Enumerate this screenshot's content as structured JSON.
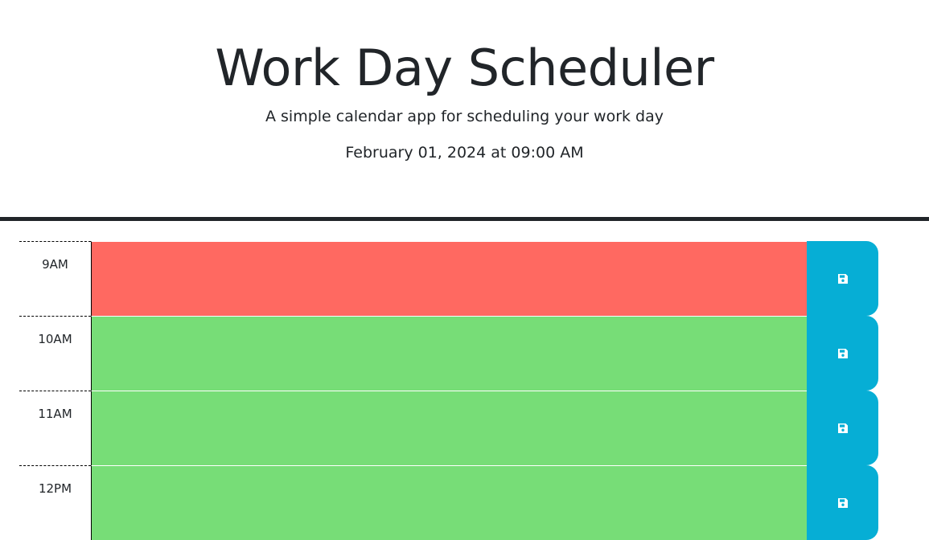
{
  "header": {
    "title": "Work Day Scheduler",
    "lead": "A simple calendar app for scheduling your work day",
    "current_day": "February 01, 2024 at 09:00 AM"
  },
  "colors": {
    "present": "#ff6961",
    "future": "#77dd77",
    "save_button": "#06aed5"
  },
  "time_blocks": [
    {
      "hour": "9AM",
      "text": "",
      "status": "present",
      "save_icon": "floppy-disk-icon"
    },
    {
      "hour": "10AM",
      "text": "",
      "status": "future",
      "save_icon": "floppy-disk-icon"
    },
    {
      "hour": "11AM",
      "text": "",
      "status": "future",
      "save_icon": "floppy-disk-icon"
    },
    {
      "hour": "12PM",
      "text": "",
      "status": "future",
      "save_icon": "floppy-disk-icon"
    }
  ]
}
